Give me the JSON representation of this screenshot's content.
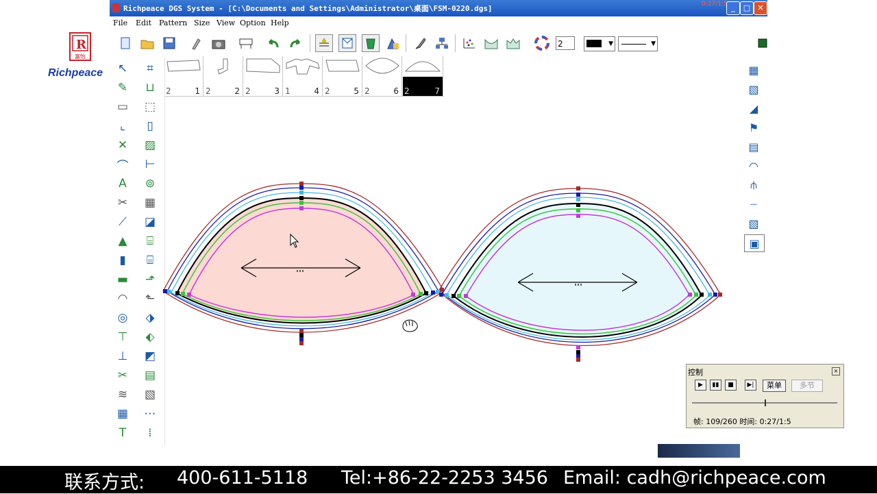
{
  "window": {
    "title": "Richpeace DGS System - [C:\\Documents and Settings\\Administrator\\桌面\\FSM-0220.dgs]",
    "overlay_text": "0:27/1:5"
  },
  "logo": {
    "text": "Richpeace",
    "mark": "R",
    "sub": "富怡"
  },
  "menu": [
    "File",
    "Edit",
    "Pattern",
    "Size",
    "View",
    "Option",
    "Help"
  ],
  "toolbar": {
    "spin_value": "2",
    "color_swatch": "#000000"
  },
  "pieces": [
    {
      "count": "2",
      "name": "1"
    },
    {
      "count": "2",
      "name": "2"
    },
    {
      "count": "2",
      "name": "3"
    },
    {
      "count": "1",
      "name": "4"
    },
    {
      "count": "2",
      "name": "5"
    },
    {
      "count": "2",
      "name": "6"
    },
    {
      "count": "2",
      "name": "7"
    }
  ],
  "control": {
    "title": "控制",
    "menu_button": "菜单",
    "step_button": "多节",
    "status": "帧: 109/260 时间: 0:27/1:5"
  },
  "footer": {
    "contact": "联系方式:",
    "hotline": "400-611-5118",
    "tel": "Tel:+86-22-2253 3456",
    "email": "Email: cadh@richpeace.com"
  },
  "colors": {
    "piece_left_fill": "#fcd9d3",
    "piece_right_fill": "#e6f7fc",
    "outer_line": "#a52a2a",
    "size_line_blue": "#1a1aa8",
    "size_line_cyan": "#48b8e0",
    "size_line_green": "#3cc43c",
    "size_line_magenta": "#c23cd6"
  }
}
